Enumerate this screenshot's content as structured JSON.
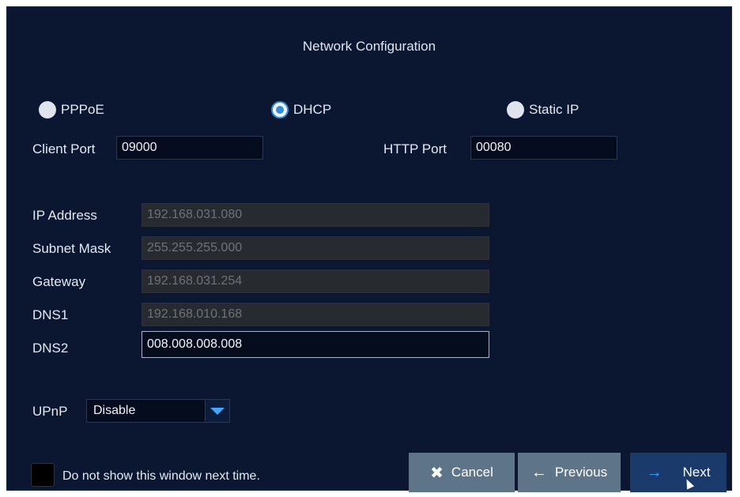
{
  "window": {
    "title": "Network Configuration"
  },
  "mode": {
    "options": [
      {
        "label": "PPPoE",
        "selected": false
      },
      {
        "label": "DHCP",
        "selected": true
      },
      {
        "label": "Static IP",
        "selected": false
      }
    ]
  },
  "ports": {
    "client_label": "Client Port",
    "client_value": "09000",
    "http_label": "HTTP Port",
    "http_value": "00080"
  },
  "network": {
    "ip_label": "IP Address",
    "ip_value": "192.168.031.080",
    "subnet_label": "Subnet Mask",
    "subnet_value": "255.255.255.000",
    "gateway_label": "Gateway",
    "gateway_value": "192.168.031.254",
    "dns1_label": "DNS1",
    "dns1_value": "192.168.010.168",
    "dns2_label": "DNS2",
    "dns2_value": "008.008.008.008"
  },
  "upnp": {
    "label": "UPnP",
    "selected": "Disable"
  },
  "footer": {
    "checkbox_label": "Do not show this window next time.",
    "cancel_label": "Cancel",
    "previous_label": "Previous",
    "next_label": "Next"
  },
  "colors": {
    "background": "#0b1731",
    "accent": "#2f8ee0",
    "button_gray": "#5d7489",
    "button_primary": "#1a3a6b"
  }
}
